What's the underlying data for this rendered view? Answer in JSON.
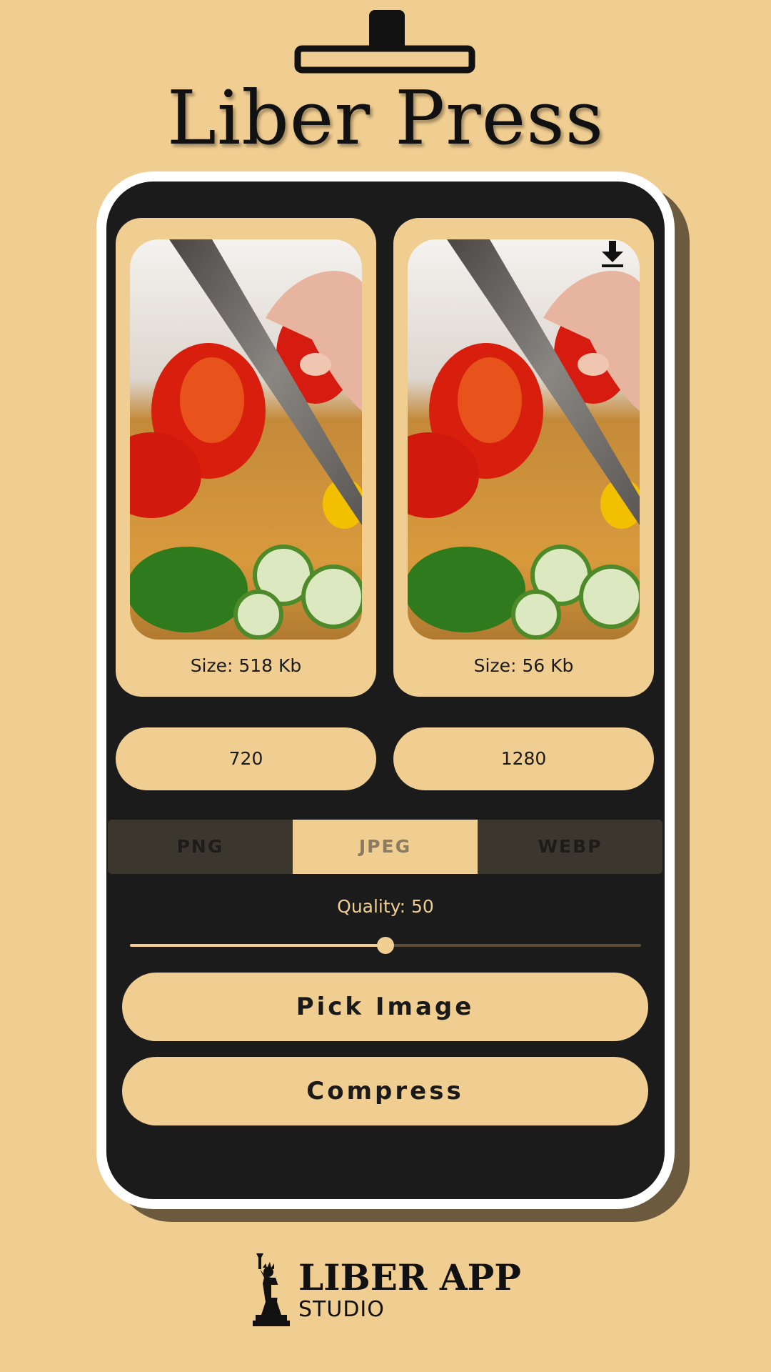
{
  "app": {
    "title": "Liber Press"
  },
  "preview": {
    "original_size": "Size: 518 Kb",
    "compressed_size": "Size: 56 Kb"
  },
  "dimensions": {
    "width_value": "720",
    "height_value": "1280"
  },
  "formats": {
    "tabs": [
      "PNG",
      "JPEG",
      "WEBP"
    ],
    "selected": "JPEG"
  },
  "quality": {
    "label": "Quality: 50",
    "value": 50
  },
  "buttons": {
    "pick_image": "Pick Image",
    "compress": "Compress"
  },
  "footer": {
    "brand": "LIBER APP",
    "sub": "STUDIO"
  },
  "colors": {
    "background": "#F0CD91",
    "panel": "#1B1B1B",
    "accent": "#F0CD91"
  },
  "icons": {
    "press": "press-icon",
    "download": "download-icon",
    "statue": "statue-of-liberty-icon"
  }
}
